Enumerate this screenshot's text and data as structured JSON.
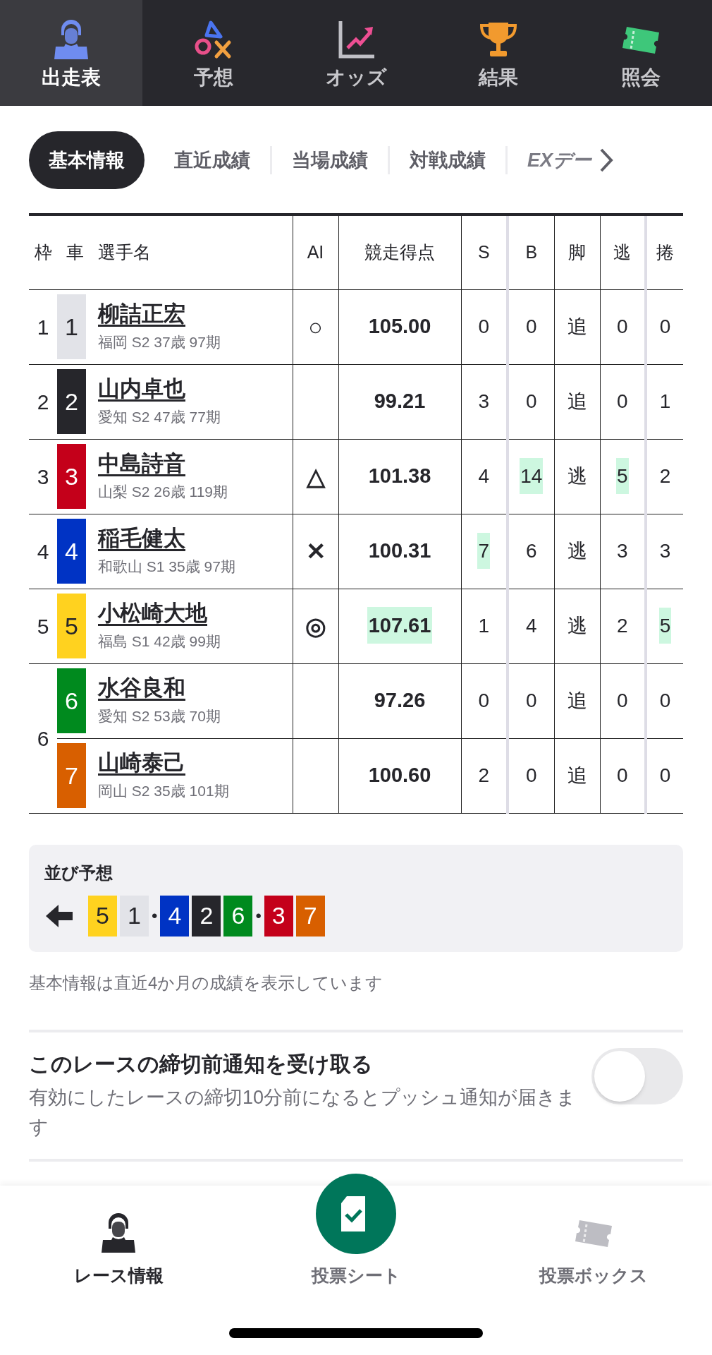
{
  "top_tabs": [
    {
      "label": "出走表",
      "selected": true
    },
    {
      "label": "予想",
      "selected": false
    },
    {
      "label": "オッズ",
      "selected": false
    },
    {
      "label": "結果",
      "selected": false
    },
    {
      "label": "照会",
      "selected": false
    }
  ],
  "sub_tabs": [
    {
      "label": "基本情報",
      "selected": true,
      "kind": "plain"
    },
    {
      "label": "直近成績",
      "selected": false,
      "kind": "plain"
    },
    {
      "label": "当場成績",
      "selected": false,
      "kind": "plain"
    },
    {
      "label": "対戦成績",
      "selected": false,
      "kind": "plain"
    },
    {
      "label": "EXデー",
      "selected": false,
      "kind": "ex"
    }
  ],
  "table": {
    "columns": [
      "枠",
      "車",
      "選手名",
      "AI",
      "競走得点",
      "S",
      "B",
      "脚",
      "逃",
      "捲"
    ],
    "frames": [
      {
        "frame": "1",
        "riders": [
          {
            "car": "1",
            "color": "#e2e3e8",
            "name": "柳詰正宏",
            "info": "福岡 S2 37歳 97期",
            "ai": "○",
            "score": {
              "value": "105.00",
              "highlight": false
            },
            "stats": [
              {
                "value": "0",
                "highlight": false
              },
              {
                "value": "0",
                "highlight": false
              },
              {
                "value": "追",
                "highlight": false
              },
              {
                "value": "0",
                "highlight": false
              },
              {
                "value": "0",
                "highlight": false
              }
            ]
          }
        ]
      },
      {
        "frame": "2",
        "riders": [
          {
            "car": "2",
            "color": "#26262b",
            "name": "山内卓也",
            "info": "愛知 S2 47歳 77期",
            "score": {
              "value": "99.21",
              "highlight": false
            },
            "stats": [
              {
                "value": "3",
                "highlight": false
              },
              {
                "value": "0",
                "highlight": false
              },
              {
                "value": "追",
                "highlight": false
              },
              {
                "value": "0",
                "highlight": false
              },
              {
                "value": "1",
                "highlight": false
              }
            ]
          }
        ]
      },
      {
        "frame": "3",
        "riders": [
          {
            "car": "3",
            "color": "#c4001a",
            "name": "中島詩音",
            "info": "山梨 S2 26歳 119期",
            "ai": "△",
            "score": {
              "value": "101.38",
              "highlight": false
            },
            "stats": [
              {
                "value": "4",
                "highlight": false
              },
              {
                "value": "14",
                "highlight": true
              },
              {
                "value": "逃",
                "highlight": false
              },
              {
                "value": "5",
                "highlight": true
              },
              {
                "value": "2",
                "highlight": false
              }
            ]
          }
        ]
      },
      {
        "frame": "4",
        "riders": [
          {
            "car": "4",
            "color": "#0033c4",
            "name": "稲毛健太",
            "info": "和歌山 S1 35歳 97期",
            "ai": "✕",
            "score": {
              "value": "100.31",
              "highlight": false
            },
            "stats": [
              {
                "value": "7",
                "highlight": true
              },
              {
                "value": "6",
                "highlight": false
              },
              {
                "value": "逃",
                "highlight": false
              },
              {
                "value": "3",
                "highlight": false
              },
              {
                "value": "3",
                "highlight": false
              }
            ]
          }
        ]
      },
      {
        "frame": "5",
        "riders": [
          {
            "car": "5",
            "color": "#ffd21f",
            "name": "小松崎大地",
            "info": "福島 S1 42歳 99期",
            "ai": "◎",
            "score": {
              "value": "107.61",
              "highlight": true
            },
            "stats": [
              {
                "value": "1",
                "highlight": false
              },
              {
                "value": "4",
                "highlight": false
              },
              {
                "value": "逃",
                "highlight": false
              },
              {
                "value": "2",
                "highlight": false
              },
              {
                "value": "5",
                "highlight": true
              }
            ]
          }
        ]
      },
      {
        "frame": "6",
        "riders": [
          {
            "car": "6",
            "color": "#008a1e",
            "name": "水谷良和",
            "info": "愛知 S2 53歳 70期",
            "score": {
              "value": "97.26",
              "highlight": false
            },
            "stats": [
              {
                "value": "0",
                "highlight": false
              },
              {
                "value": "0",
                "highlight": false
              },
              {
                "value": "追",
                "highlight": false
              },
              {
                "value": "0",
                "highlight": false
              },
              {
                "value": "0",
                "highlight": false
              }
            ]
          },
          {
            "car": "7",
            "color": "#d85f00",
            "name": "山崎泰己",
            "info": "岡山 S2 35歳 101期",
            "score": {
              "value": "100.60",
              "highlight": false
            },
            "stats": [
              {
                "value": "2",
                "highlight": false
              },
              {
                "value": "0",
                "highlight": false
              },
              {
                "value": "追",
                "highlight": false
              },
              {
                "value": "0",
                "highlight": false
              },
              {
                "value": "0",
                "highlight": false
              }
            ]
          }
        ]
      }
    ]
  },
  "line_prediction": {
    "title": "並び予想",
    "items": [
      {
        "kind": "car",
        "number": "5",
        "color": "#ffd21f"
      },
      {
        "kind": "car",
        "number": "1",
        "color": "#e2e3e8"
      },
      {
        "kind": "dot",
        "text": "•"
      },
      {
        "kind": "car",
        "number": "4",
        "color": "#0033c4"
      },
      {
        "kind": "car",
        "number": "2",
        "color": "#26262b"
      },
      {
        "kind": "car",
        "number": "6",
        "color": "#008a1e"
      },
      {
        "kind": "dot",
        "text": "•"
      },
      {
        "kind": "car",
        "number": "3",
        "color": "#c4001a"
      },
      {
        "kind": "car",
        "number": "7",
        "color": "#d85f00"
      }
    ]
  },
  "note": "基本情報は直近4か月の成績を表示しています",
  "notification": {
    "title": "このレースの締切前通知を受け取る",
    "description": "有効にしたレースの締切10分前になるとプッシュ通知が届きます",
    "on": false
  },
  "bottom_nav": [
    {
      "label": "レース情報",
      "selected": true,
      "kind": "plain"
    },
    {
      "label": "投票シート",
      "selected": false,
      "kind": "primary"
    },
    {
      "label": "投票ボックス",
      "selected": false,
      "kind": "plain"
    }
  ]
}
